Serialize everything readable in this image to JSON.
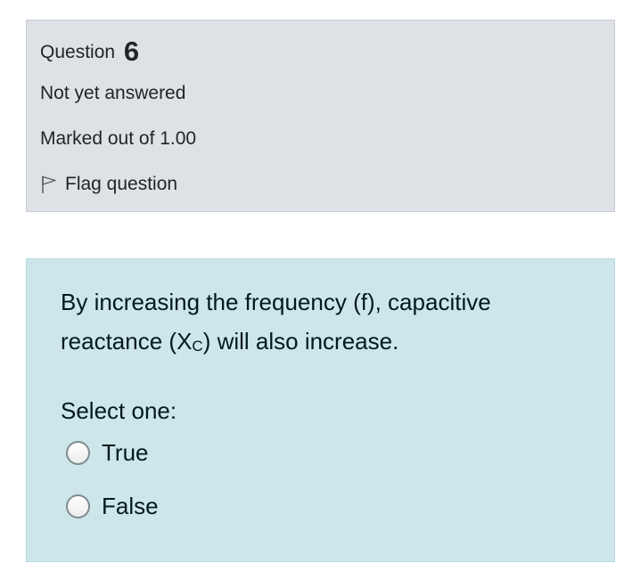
{
  "info": {
    "question_label": "Question",
    "question_number": "6",
    "state": "Not yet answered",
    "grade": "Marked out of 1.00",
    "flag_label": "Flag question"
  },
  "content": {
    "text_part1": "By increasing the frequency (f), capacitive reactance (X",
    "text_subscript": "C",
    "text_part2": ") will also increase.",
    "prompt": "Select one:",
    "options": [
      {
        "label": "True",
        "selected": false
      },
      {
        "label": "False",
        "selected": false
      }
    ]
  },
  "colors": {
    "info_background": "#dee2e6",
    "content_background": "#cce6ea",
    "text": "#212529",
    "question_text": "#001a1e"
  },
  "icons": {
    "flag": "flag-outline-icon",
    "radio": "radio-unchecked-icon"
  }
}
